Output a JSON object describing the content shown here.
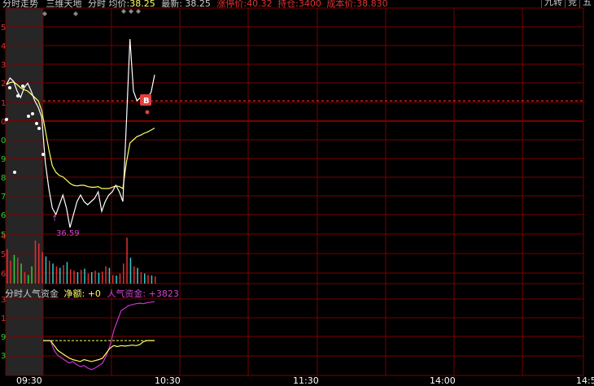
{
  "header": {
    "title": "分时走势",
    "stock_name": "三维天地",
    "avg_label": "分时 均价:",
    "avg_value": "38.25",
    "latest_label": "最新:",
    "latest_value": "38.25",
    "limit_label": "涨停价:",
    "limit_value": "40.32",
    "position_label": "持仓:",
    "position_value": "3400",
    "cost_label": "成本价:",
    "cost_value": "38.830",
    "tabs": [
      "九转",
      "竞",
      "五"
    ]
  },
  "price_axis": [
    "5",
    "4",
    "3",
    "2",
    "1",
    "0",
    "0",
    "9",
    "8",
    "7",
    "6",
    "5"
  ],
  "volume_axis": [
    "4",
    "5",
    "6"
  ],
  "fund_panel": {
    "title": "分时人气资金",
    "net_label": "净额:",
    "net_value": "+0",
    "popularity_label": "人气资金:",
    "popularity_value": "+3823",
    "axis": [
      "3",
      "1",
      "9",
      "3"
    ]
  },
  "time_axis": [
    "09:30",
    "10:30",
    "11:30",
    "14:00",
    "14:5"
  ],
  "markers": {
    "buy": "B",
    "low_label": "36.59"
  },
  "colors": {
    "grid": "#7a0000",
    "axis_red": "#e03030",
    "axis_green": "#33cc33",
    "price_line": "#ffffff",
    "avg_line": "#ffff66",
    "fund_line": "#cc33cc",
    "cost_line": "#ff3333",
    "auction_bg": "#262626",
    "badge": "#e04040",
    "label": "#ffffff",
    "net_color": "#ffff66",
    "pop_color": "#cc44cc"
  },
  "chart_data": [
    {
      "type": "line",
      "panel": "price",
      "series": [
        {
          "values": [
            38.8,
            38.9,
            38.85,
            38.7,
            38.6,
            38.75,
            38.82,
            38.7,
            38.55,
            38.45,
            38.3,
            37.6,
            37.2,
            36.9,
            36.8,
            36.95,
            37.1,
            36.9,
            36.6,
            36.8,
            37.0,
            37.1,
            37.0,
            36.95,
            37.0,
            37.05,
            37.15,
            36.85,
            37.0,
            37.1,
            37.15,
            37.25,
            37.15,
            37.0,
            38.2,
            39.5,
            38.7,
            38.55,
            38.6,
            38.5,
            38.6,
            38.68,
            38.95
          ]
        },
        {
          "values": [
            38.8,
            38.83,
            38.84,
            38.8,
            38.75,
            38.72,
            38.7,
            38.65,
            38.6,
            38.55,
            38.4,
            38.1,
            37.8,
            37.55,
            37.45,
            37.4,
            37.38,
            37.33,
            37.28,
            37.25,
            37.24,
            37.25,
            37.25,
            37.23,
            37.22,
            37.22,
            37.23,
            37.2,
            37.2,
            37.2,
            37.22,
            37.24,
            37.23,
            37.2,
            37.6,
            37.9,
            37.95,
            38.0,
            38.02,
            38.05,
            38.07,
            38.1,
            38.13
          ]
        }
      ]
    },
    {
      "type": "bar",
      "panel": "volume",
      "values": [
        120,
        80,
        100,
        90,
        70,
        40,
        30,
        60,
        150,
        140,
        110,
        95,
        80,
        70,
        60,
        55,
        65,
        75,
        50,
        45,
        40,
        48,
        52,
        35,
        40,
        45,
        38,
        42,
        60,
        55,
        30,
        28,
        35,
        70,
        160,
        90,
        60,
        55,
        40,
        35,
        30,
        28,
        25
      ],
      "direction": [
        "up",
        "up",
        "down",
        "up",
        "down",
        "up",
        "down",
        "down",
        "up",
        "up",
        "up",
        "down",
        "up",
        "down",
        "up",
        "down",
        "up",
        "down",
        "up",
        "up",
        "down",
        "up",
        "down",
        "up",
        "down",
        "up",
        "down",
        "up",
        "up",
        "down",
        "up",
        "down",
        "up",
        "up",
        "up",
        "down",
        "up",
        "down",
        "up",
        "down",
        "up",
        "down",
        "up"
      ]
    },
    {
      "type": "line",
      "panel": "fund",
      "series": [
        {
          "values": [
            0,
            0,
            0,
            -20,
            -30,
            -35,
            -40,
            -45,
            -42,
            -48,
            -52,
            -50,
            -55,
            -58,
            -55,
            -50,
            -45,
            -30,
            -10,
            20,
            40,
            60,
            65,
            70,
            72,
            74,
            75,
            74,
            76,
            77,
            78
          ]
        },
        {
          "values": [
            0,
            0,
            0,
            -10,
            -20,
            -25,
            -30,
            -35,
            -38,
            -40,
            -42,
            -38,
            -40,
            -42,
            -40,
            -38,
            -35,
            -25,
            -15,
            -10,
            -12,
            -10,
            -11,
            -10,
            -9,
            -10,
            -8,
            -2,
            0,
            0,
            0
          ]
        }
      ]
    }
  ]
}
